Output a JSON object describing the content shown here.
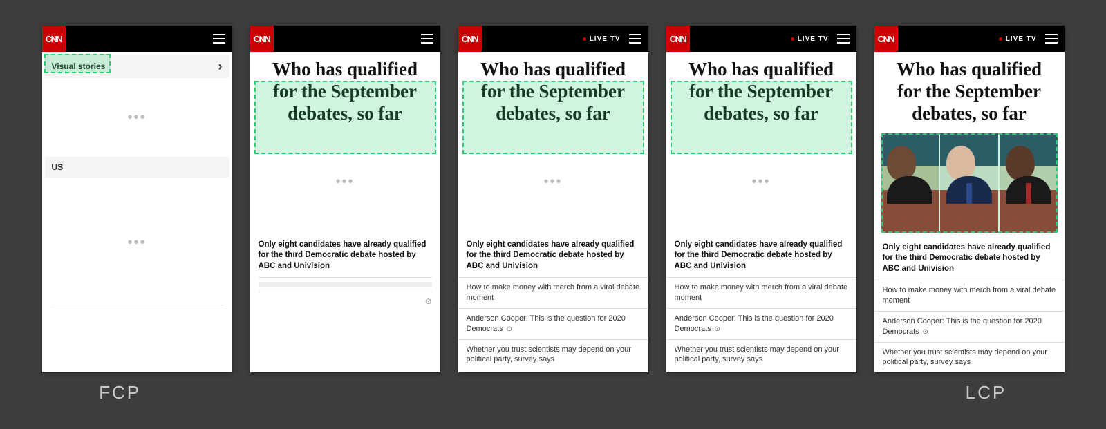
{
  "logo_text": "CNN",
  "live_tv": "LIVE TV",
  "sections": {
    "visual_stories": "Visual stories",
    "us": "US"
  },
  "headline": "Who has qualified for the September debates, so far",
  "sub_lead": "Only eight candidates have already qualified for the third Democratic debate hosted by ABC and Univision",
  "links": {
    "merch": "How to make money with merch from a viral debate moment",
    "cooper": "Anderson Cooper: This is the question for 2020 Democrats",
    "scientists": "Whether you trust scientists may depend on your political party, survey says"
  },
  "labels": {
    "fcp": "FCP",
    "lcp": "LCP"
  },
  "colors": {
    "brand_red": "#cc0000",
    "highlight_green": "#2ecc71"
  }
}
